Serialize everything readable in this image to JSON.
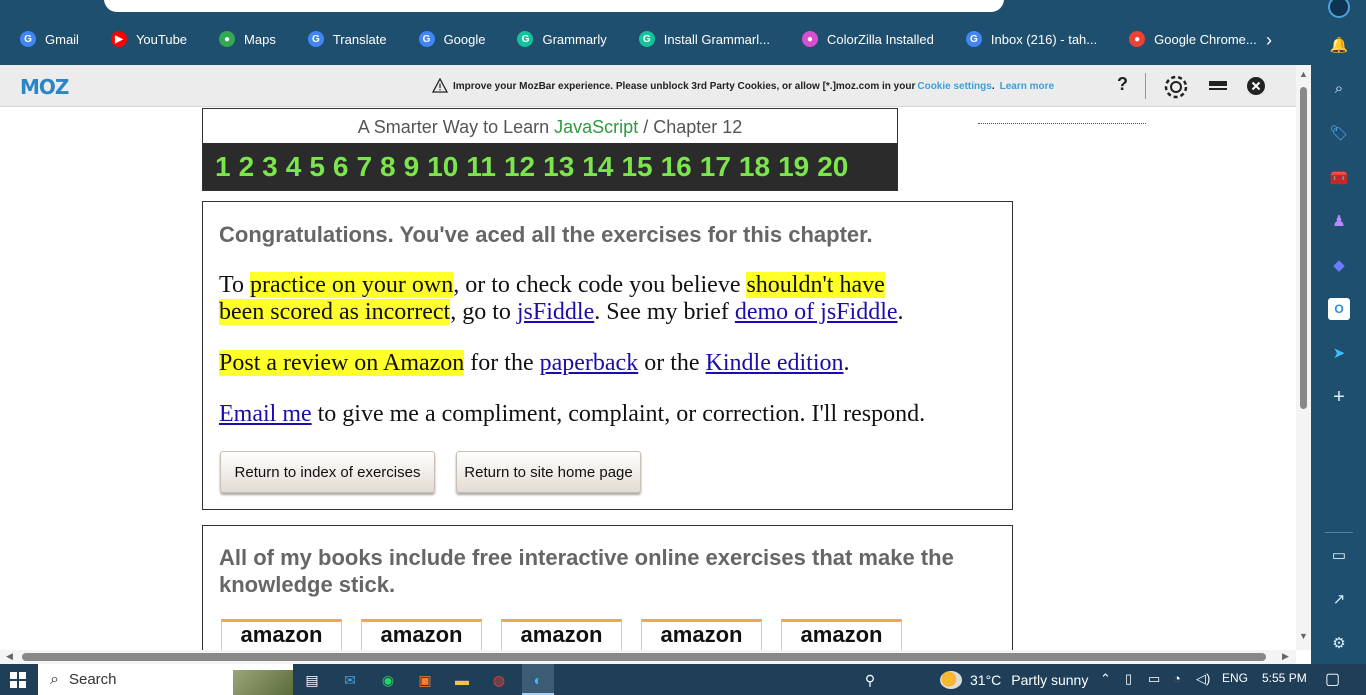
{
  "bookmarks": [
    {
      "label": "Gmail",
      "icon": "google-icon",
      "color": "#4285f4",
      "glyph": "G"
    },
    {
      "label": "YouTube",
      "icon": "youtube-icon",
      "color": "#ff0000",
      "glyph": "▶"
    },
    {
      "label": "Maps",
      "icon": "maps-icon",
      "color": "#34a853",
      "glyph": "●"
    },
    {
      "label": "Translate",
      "icon": "translate-icon",
      "color": "#4285f4",
      "glyph": "G"
    },
    {
      "label": "Google",
      "icon": "google-icon",
      "color": "#4285f4",
      "glyph": "G"
    },
    {
      "label": "Grammarly",
      "icon": "grammarly-icon",
      "color": "#15c39a",
      "glyph": "G"
    },
    {
      "label": "Install Grammarl...",
      "icon": "grammarly-icon",
      "color": "#15c39a",
      "glyph": "G"
    },
    {
      "label": "ColorZilla Installed",
      "icon": "colorzilla-icon",
      "color": "#d94fd0",
      "glyph": "●"
    },
    {
      "label": "Inbox (216) - tah...",
      "icon": "google-icon",
      "color": "#4285f4",
      "glyph": "G"
    },
    {
      "label": "Google Chrome...",
      "icon": "chrome-icon",
      "color": "#ea4335",
      "glyph": "●"
    }
  ],
  "mozbar": {
    "logo": "MOZ",
    "warning": "Improve your MozBar experience. Please unblock 3rd Party Cookies, or allow [*.]moz.com in your",
    "cookie_link": "Cookie settings",
    "period": ".",
    "learn_more": "Learn more",
    "help": "?"
  },
  "chapter": {
    "prefix": "A Smarter Way to Learn ",
    "subject": "JavaScript",
    "suffix": "  /  Chapter 12",
    "numbers": [
      "1",
      "2",
      "3",
      "4",
      "5",
      "6",
      "7",
      "8",
      "9",
      "10",
      "11",
      "12",
      "13",
      "14",
      "15",
      "16",
      "17",
      "18",
      "19",
      "20"
    ]
  },
  "congrats": {
    "title": "Congratulations. You've aced all the exercises for this chapter.",
    "p1": {
      "t1": "To ",
      "h1": "practice on your own",
      "t2": ", or to check code you believe ",
      "h2a": "shouldn't have",
      "h2b": "been scored as incorrect",
      "t3": ", go to ",
      "l1": "jsFiddle",
      "t4": ". See my brief ",
      "l2": "demo of jsFiddle",
      "t5": "."
    },
    "p2": {
      "h1": "Post a review on Amazon",
      "t1": " for the ",
      "l1": "paperback",
      "t2": " or the ",
      "l2": "Kindle edition",
      "t3": "."
    },
    "p3": {
      "l1": "Email me",
      "t1": " to give me a compliment, complaint, or correction. I'll respond."
    },
    "buttons": {
      "index": "Return to index of exercises",
      "home": "Return to site home page"
    }
  },
  "books": {
    "title": " All of my books include free interactive online exercises that make the knowledge stick.",
    "amazon_label": "amazon"
  },
  "taskbar": {
    "search_placeholder": "Search",
    "weather_temp": "31°C",
    "weather_desc": "Partly sunny",
    "language": "ENG",
    "time": "5:55 PM"
  },
  "colors": {
    "chrome": "#1f4f6e",
    "highlight": "#ffff2a",
    "chapter_numbers": "#7be54c",
    "javascript": "#2e9a3f",
    "link": "#1a0dab"
  }
}
